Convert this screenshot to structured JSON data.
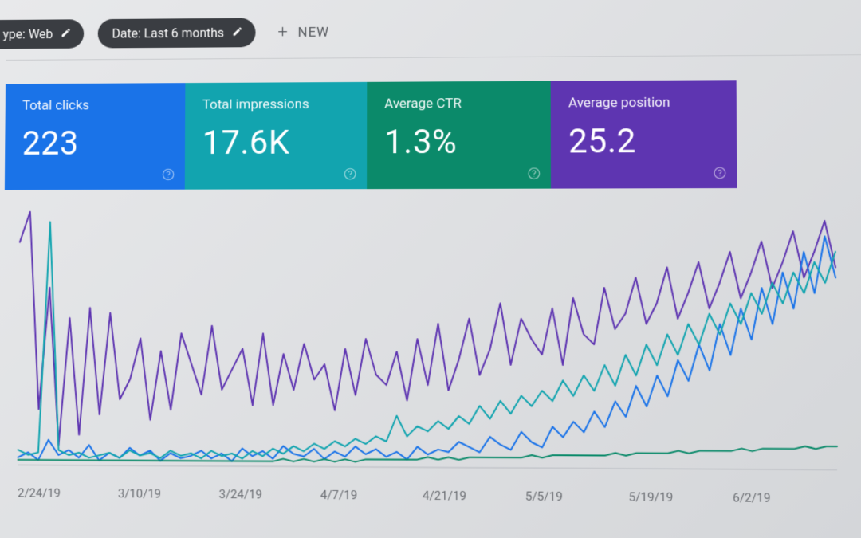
{
  "filters": {
    "type_chip_label": "ype: Web",
    "date_chip_label": "Date: Last 6 months",
    "new_button_label": "NEW"
  },
  "kpi": {
    "clicks": {
      "label": "Total clicks",
      "value": "223",
      "color": "#1a73e8"
    },
    "impressions": {
      "label": "Total impressions",
      "value": "17.6K",
      "color": "#12a4af"
    },
    "ctr": {
      "label": "Average CTR",
      "value": "1.3%",
      "color": "#0b8a6a"
    },
    "position": {
      "label": "Average position",
      "value": "25.2",
      "color": "#5e35b1"
    }
  },
  "chart_data": {
    "type": "line",
    "title": "",
    "xlabel": "",
    "ylabel": "",
    "x_tick_labels": [
      "2/24/19",
      "3/10/19",
      "3/24/19",
      "4/7/19",
      "4/21/19",
      "5/5/19",
      "5/19/19",
      "6/2/19"
    ],
    "ylim": [
      0,
      100
    ],
    "colors": {
      "clicks": "#1a73e8",
      "impressions": "#12a4af",
      "ctr": "#0b8a6a",
      "position": "#5e35b1"
    },
    "series": [
      {
        "name": "Average position",
        "color": "#5e35b1",
        "values": [
          88,
          100,
          22,
          70,
          8,
          58,
          12,
          62,
          20,
          60,
          26,
          34,
          50,
          18,
          45,
          22,
          52,
          40,
          28,
          55,
          30,
          38,
          46,
          24,
          52,
          24,
          44,
          30,
          48,
          34,
          40,
          22,
          46,
          28,
          50,
          36,
          32,
          45,
          26,
          50,
          32,
          56,
          30,
          42,
          58,
          36,
          46,
          64,
          40,
          58,
          50,
          44,
          62,
          40,
          66,
          52,
          48,
          70,
          54,
          60,
          74,
          56,
          64,
          78,
          58,
          68,
          80,
          62,
          72,
          84,
          66,
          76,
          88,
          70,
          80,
          92,
          74,
          84,
          96,
          78
        ]
      },
      {
        "name": "Total clicks",
        "color": "#1a73e8",
        "values": [
          3,
          5,
          2,
          10,
          4,
          6,
          3,
          8,
          2,
          5,
          3,
          7,
          4,
          6,
          2,
          5,
          3,
          4,
          6,
          3,
          5,
          2,
          7,
          4,
          6,
          3,
          8,
          5,
          4,
          7,
          3,
          6,
          4,
          8,
          5,
          7,
          4,
          6,
          3,
          8,
          5,
          7,
          6,
          10,
          8,
          6,
          12,
          9,
          7,
          14,
          10,
          8,
          16,
          12,
          18,
          14,
          22,
          16,
          26,
          20,
          32,
          24,
          36,
          28,
          42,
          34,
          48,
          38,
          56,
          44,
          62,
          50,
          70,
          56,
          76,
          62,
          84,
          68,
          90,
          74
        ]
      },
      {
        "name": "Total impressions",
        "color": "#12a4af",
        "values": [
          6,
          4,
          5,
          96,
          6,
          4,
          5,
          3,
          4,
          5,
          3,
          6,
          4,
          5,
          3,
          6,
          4,
          5,
          3,
          6,
          4,
          5,
          3,
          6,
          4,
          7,
          5,
          8,
          6,
          9,
          7,
          10,
          8,
          11,
          9,
          12,
          10,
          20,
          12,
          16,
          14,
          18,
          15,
          20,
          17,
          24,
          19,
          26,
          21,
          28,
          24,
          30,
          26,
          34,
          28,
          36,
          30,
          40,
          32,
          44,
          36,
          48,
          40,
          52,
          44,
          56,
          48,
          60,
          52,
          64,
          56,
          68,
          60,
          72,
          64,
          76,
          68,
          80,
          72,
          84
        ]
      },
      {
        "name": "Average CTR",
        "color": "#0b8a6a",
        "values": [
          2,
          2,
          2,
          2,
          2,
          2,
          2,
          2,
          2,
          2,
          2,
          2,
          2,
          2,
          2,
          2,
          2,
          2,
          2,
          2,
          2,
          2,
          2,
          2,
          2,
          2,
          3,
          2,
          3,
          2,
          3,
          2,
          3,
          2,
          3,
          3,
          3,
          3,
          3,
          3,
          4,
          3,
          4,
          3,
          4,
          4,
          4,
          4,
          4,
          4,
          5,
          4,
          5,
          5,
          5,
          5,
          5,
          5,
          6,
          5,
          6,
          6,
          6,
          6,
          7,
          6,
          7,
          7,
          7,
          7,
          8,
          7,
          8,
          8,
          8,
          8,
          9,
          8,
          9,
          9
        ]
      }
    ]
  }
}
